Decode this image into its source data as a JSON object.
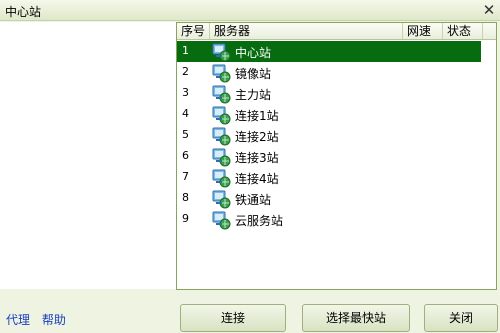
{
  "window": {
    "title": "中心站",
    "close_glyph": "✕"
  },
  "server_list": {
    "columns": {
      "number": "序号",
      "server": "服务器",
      "speed": "网速",
      "status": "状态"
    },
    "rows": [
      {
        "number": "1",
        "name": "中心站",
        "icon": "server-icon"
      },
      {
        "number": "2",
        "name": "镜像站",
        "icon": "server-icon"
      },
      {
        "number": "3",
        "name": "主力站",
        "icon": "server-icon"
      },
      {
        "number": "4",
        "name": "连接1站",
        "icon": "server-icon"
      },
      {
        "number": "5",
        "name": "连接2站",
        "icon": "server-icon"
      },
      {
        "number": "6",
        "name": "连接3站",
        "icon": "server-icon"
      },
      {
        "number": "7",
        "name": "连接4站",
        "icon": "server-icon"
      },
      {
        "number": "8",
        "name": "铁通站",
        "icon": "server-icon"
      },
      {
        "number": "9",
        "name": "云服务站",
        "icon": "server-icon"
      }
    ],
    "selected_index": 0,
    "selected_color": "#076b0f"
  },
  "links": {
    "proxy": "代理",
    "help": "帮助"
  },
  "buttons": {
    "connect": "连接",
    "select_fastest": "选择最快站",
    "close": "关闭"
  }
}
